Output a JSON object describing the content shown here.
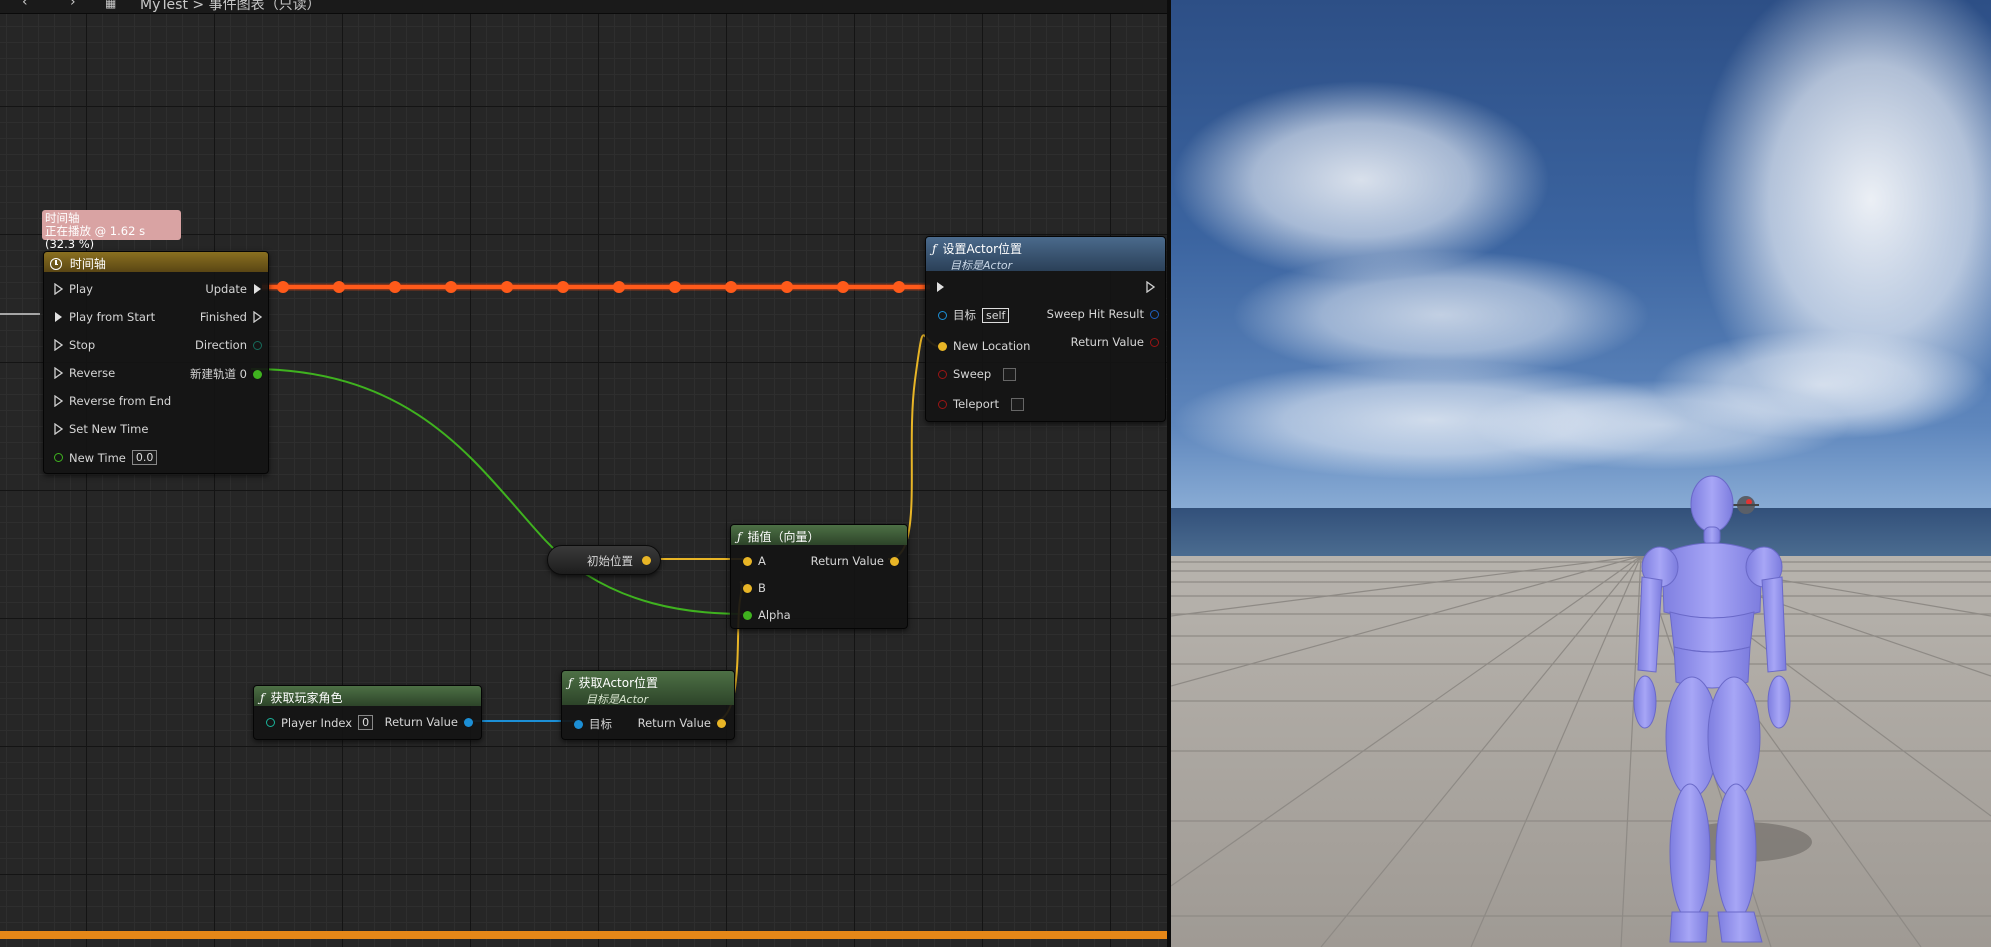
{
  "topbar": {
    "breadcrumb": "MyTest > 事件图表（只读）",
    "nav_back": "‹",
    "nav_forward": "›"
  },
  "timeline_tooltip": {
    "title": "时间轴",
    "status": "正在播放 @ 1.62 s (32.3 %)"
  },
  "timeline_node": {
    "title": "时间轴",
    "inputs": [
      "Play",
      "Play from Start",
      "Stop",
      "Reverse",
      "Reverse from End",
      "Set New Time"
    ],
    "new_time_label": "New Time",
    "new_time_value": "0.0",
    "outputs": {
      "update": "Update",
      "finished": "Finished",
      "direction": "Direction",
      "track": "新建轨道 0"
    }
  },
  "set_actor_location_node": {
    "title": "设置Actor位置",
    "subtitle": "目标是Actor",
    "target_label": "目标",
    "target_value": "self",
    "new_location": "New Location",
    "sweep": "Sweep",
    "teleport": "Teleport",
    "sweep_hit_result": "Sweep Hit Result",
    "return_value": "Return Value"
  },
  "lerp_node": {
    "title": "插值（向量）",
    "a": "A",
    "b": "B",
    "alpha": "Alpha",
    "return_value": "Return Value"
  },
  "variable_node": {
    "label": "初始位置"
  },
  "get_player_node": {
    "title": "获取玩家角色",
    "player_index_label": "Player Index",
    "player_index_value": "0",
    "return_value": "Return Value"
  },
  "get_actor_location_node": {
    "title": "获取Actor位置",
    "subtitle": "目标是Actor",
    "target_label": "目标",
    "return_value": "Return Value"
  },
  "colors": {
    "exec_wire_active": "#ff4a12",
    "float_pin": "#3fb21f",
    "vector_pin": "#e8b526",
    "object_pin": "#1c8fd6",
    "bool_pin": "#b01818",
    "struct_pin": "#1f5fc0",
    "timeline_header": "#8a7020",
    "function_header": "#4a6a8c",
    "pure_header": "#4d7045",
    "progress_bar": "#e58718"
  },
  "icons": [
    "clock-icon",
    "function-icon",
    "exec-pin-icon",
    "data-pin-icon"
  ]
}
